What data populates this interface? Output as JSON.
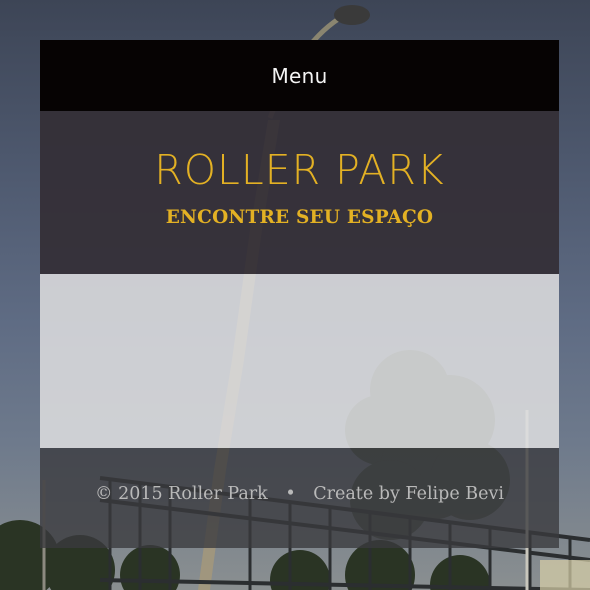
{
  "menu": {
    "label": "Menu"
  },
  "header": {
    "title": "ROLLER PARK",
    "tagline": "ENCONTRE SEU ESPAÇO"
  },
  "footer": {
    "copyright": "© 2015 Roller Park",
    "separator": "•",
    "credit": "Create by Felipe Bevi"
  },
  "colors": {
    "accent": "#e3b124",
    "menu_bar": "#060303"
  }
}
